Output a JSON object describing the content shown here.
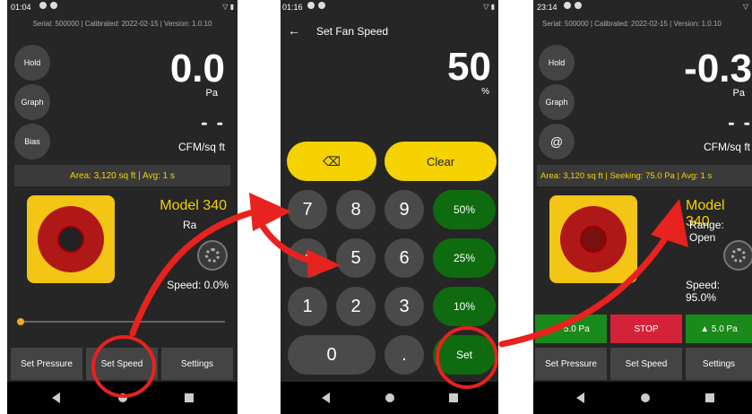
{
  "phone1": {
    "status": {
      "time": "01:04"
    },
    "info": "Serial: 500000 | Calibrated: 2022-02-15 | Version: 1.0.10",
    "buttons": [
      "Hold",
      "Graph",
      "Bias"
    ],
    "pressure": {
      "value": "0.0",
      "unit": "Pa"
    },
    "flow": {
      "value": "- -",
      "unit": "CFM/sq ft"
    },
    "area_bar": "Area: 3,120 sq ft | Avg: 1 s",
    "model": "Model 340",
    "range": "Ra",
    "speed": "Speed: 0.0%",
    "speed_fraction": 0.0,
    "bottom": [
      "Set Pressure",
      "Set Speed",
      "Settings"
    ]
  },
  "phone2": {
    "status": {
      "time": "01:16"
    },
    "back_glyph": "←",
    "title": "Set Fan Speed",
    "value": "50",
    "unit": "%",
    "backspace_glyph": "⌫",
    "clear": "Clear",
    "keys": [
      "7",
      "8",
      "9",
      "4",
      "5",
      "6",
      "1",
      "2",
      "3",
      "0",
      "."
    ],
    "presets": [
      "50%",
      "25%",
      "10%"
    ],
    "set": "Set"
  },
  "phone3": {
    "status": {
      "time": "23:14"
    },
    "info": "Serial: 500000 | Calibrated: 2022-02-15 | Version: 1.0.10",
    "buttons": [
      "Hold",
      "Graph",
      "@"
    ],
    "pressure": {
      "value": "-0.3",
      "unit": "Pa"
    },
    "flow": {
      "value": "- -",
      "unit": "CFM/sq ft"
    },
    "area_bar": "Area: 3,120 sq ft | Seeking: 75.0 Pa | Avg: 1 s",
    "model": "Model 340",
    "range": "Range: Open",
    "speed": "Speed: 95.0%",
    "controls": {
      "down": "▼ 5.0 Pa",
      "stop": "STOP",
      "up": "▲ 5.0 Pa"
    },
    "bottom": [
      "Set Pressure",
      "Set Speed",
      "Settings"
    ]
  },
  "colors": {
    "accent_yellow": "#f5d200",
    "stop_red": "#d42338",
    "go_green": "#0f6b0f",
    "annotation_red": "#e8221e"
  }
}
